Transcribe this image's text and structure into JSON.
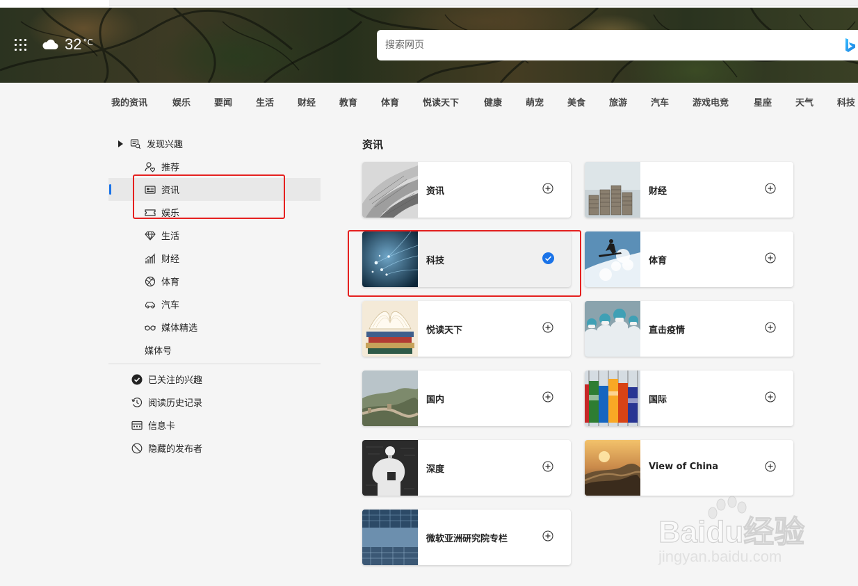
{
  "header": {
    "weather": {
      "temp": "32",
      "unit": "°C"
    },
    "search": {
      "placeholder": "搜索网页"
    }
  },
  "categories": [
    "我的资讯",
    "娱乐",
    "要闻",
    "生活",
    "财经",
    "教育",
    "体育",
    "悦读天下",
    "健康",
    "萌宠",
    "美食",
    "旅游",
    "汽车",
    "游戏电竞",
    "星座",
    "天气",
    "科技"
  ],
  "sidebar": {
    "discover": "发现兴趣",
    "items": [
      {
        "label": "推荐",
        "icon": "person-heart-icon"
      },
      {
        "label": "资讯",
        "icon": "newspaper-icon",
        "selected": true
      },
      {
        "label": "娱乐",
        "icon": "ticket-icon"
      },
      {
        "label": "生活",
        "icon": "diamond-icon"
      },
      {
        "label": "财经",
        "icon": "chart-icon"
      },
      {
        "label": "体育",
        "icon": "ball-icon"
      },
      {
        "label": "汽车",
        "icon": "car-icon"
      },
      {
        "label": "媒体精选",
        "icon": "glasses-icon"
      }
    ],
    "media": "媒体号",
    "bottom": [
      {
        "label": "已关注的兴趣",
        "icon": "check-circle-icon"
      },
      {
        "label": "阅读历史记录",
        "icon": "history-icon"
      },
      {
        "label": "信息卡",
        "icon": "card-icon"
      },
      {
        "label": "隐藏的发布者",
        "icon": "block-icon"
      }
    ]
  },
  "content": {
    "title": "资讯",
    "cards": [
      {
        "label": "资讯",
        "followed": false
      },
      {
        "label": "财经",
        "followed": false
      },
      {
        "label": "科技",
        "followed": true
      },
      {
        "label": "体育",
        "followed": false
      },
      {
        "label": "悦读天下",
        "followed": false
      },
      {
        "label": "直击疫情",
        "followed": false
      },
      {
        "label": "国内",
        "followed": false
      },
      {
        "label": "国际",
        "followed": false
      },
      {
        "label": "深度",
        "followed": false
      },
      {
        "label": "View of China",
        "followed": false
      },
      {
        "label": "微软亚洲研究院专栏",
        "followed": false
      }
    ]
  },
  "watermark": {
    "brand": "Baidu经验",
    "url": "jingyan.baidu.com"
  },
  "colors": {
    "accent": "#1a73e8",
    "highlight": "#e5201f"
  }
}
